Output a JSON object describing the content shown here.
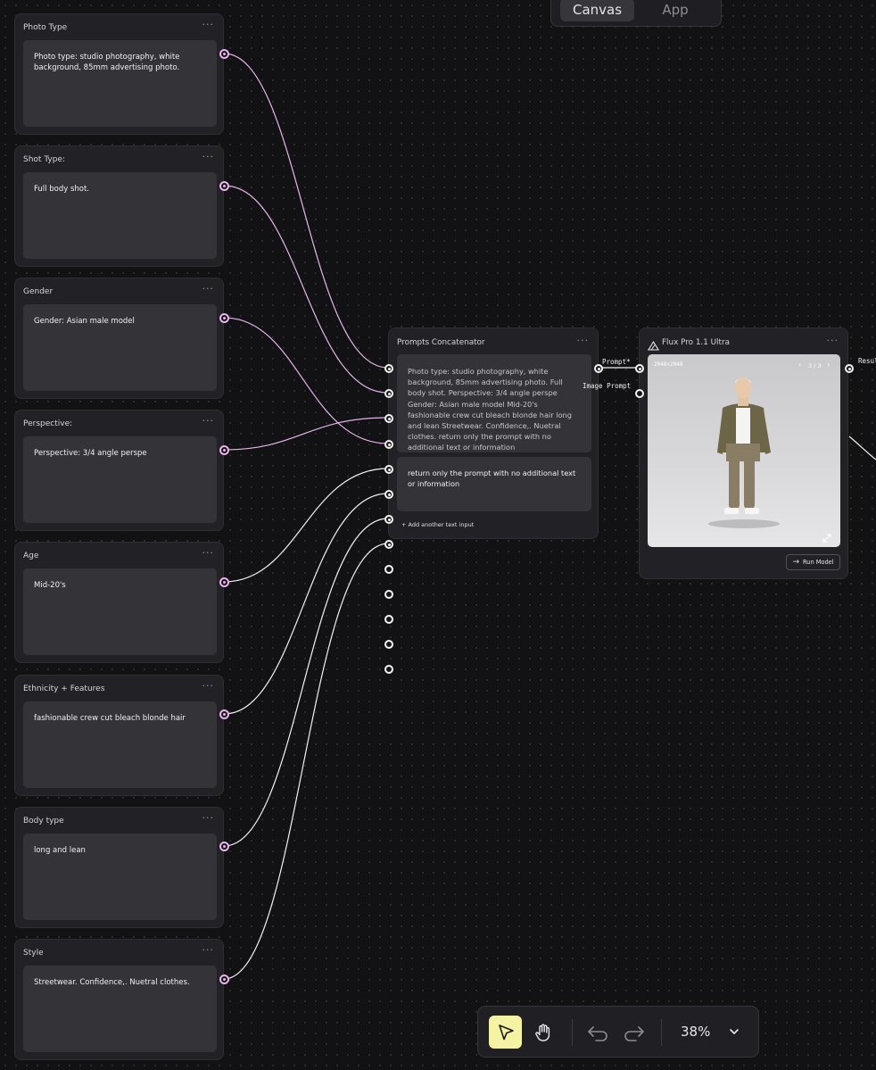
{
  "view_switch": {
    "canvas_label": "Canvas",
    "app_label": "App"
  },
  "text_nodes": [
    {
      "title": "Photo Type",
      "text": "Photo type: studio photography, white background, 85mm advertising photo."
    },
    {
      "title": "Shot Type:",
      "text": "Full body shot."
    },
    {
      "title": "Gender",
      "text": "Gender: Asian male model"
    },
    {
      "title": "Perspective:",
      "text": "Perspective: 3/4 angle perspe"
    },
    {
      "title": "Age",
      "text": "Mid-20's"
    },
    {
      "title": "Ethnicity + Features",
      "text": "fashionable crew cut bleach blonde hair"
    },
    {
      "title": "Body type",
      "text": "long and lean"
    },
    {
      "title": "Style",
      "text": "Streetwear. Confidence,. Nuetral clothes."
    }
  ],
  "menu_dots": "···",
  "concatenator": {
    "title": "Prompts Concatenator",
    "combined_text": "Photo type: studio photography, white background, 85mm advertising photo. Full body shot. Perspective: 3/4 angle perspe Gender: Asian male model Mid-20's fashionable crew cut bleach blonde hair long and lean Streetwear. Confidence,. Nuetral clothes. return only the prompt with no additional text or information",
    "extra_input_text": "return only the prompt with no additional text or information",
    "add_input_label": "+ Add another text input",
    "output_label": "Prompt*"
  },
  "model_node": {
    "title": "Flux Pro 1.1 Ultra",
    "prompt_input_label": "Prompt*",
    "image_prompt_label": "Image Prompt",
    "resolution": "2048×2048",
    "pagination": "3 / 3",
    "run_label": "Run Model",
    "output_label": "Resul"
  },
  "toolbar": {
    "zoom": "38%"
  },
  "colors": {
    "wire": "#e4b6ea",
    "wire_white": "#f2f2f2",
    "select_active": "#f4f3a4"
  },
  "icons": [
    "triangle-logo-icon",
    "chevron-left-icon",
    "chevron-right-icon",
    "expand-icon",
    "arrow-right-icon",
    "pointer-icon",
    "hand-icon",
    "undo-icon",
    "redo-icon",
    "chevron-down-icon"
  ]
}
